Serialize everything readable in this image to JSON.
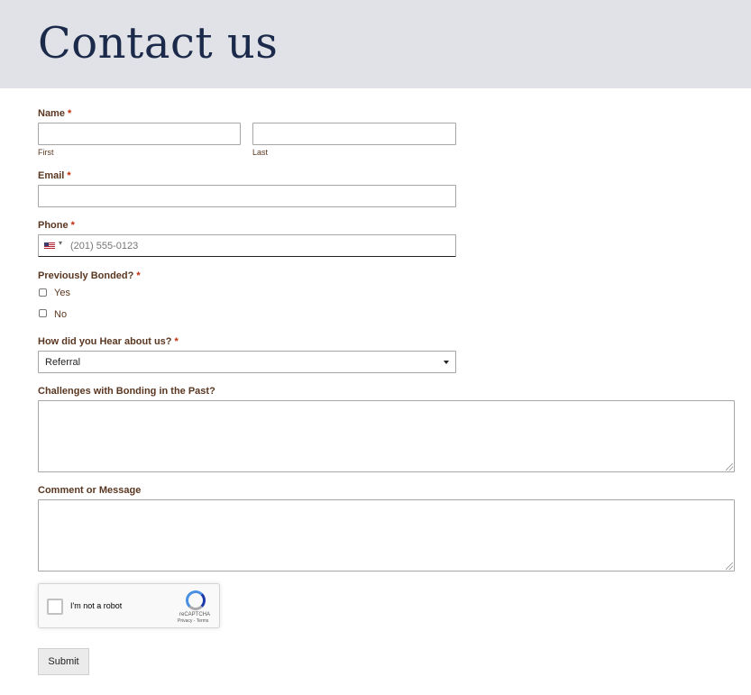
{
  "header": {
    "title": "Contact us"
  },
  "form": {
    "name": {
      "label": "Name",
      "required": "*",
      "first_sublabel": "First",
      "last_sublabel": "Last",
      "first_value": "",
      "last_value": ""
    },
    "email": {
      "label": "Email",
      "required": "*",
      "value": ""
    },
    "phone": {
      "label": "Phone",
      "required": "*",
      "country": "US",
      "caret": "▾",
      "placeholder": "(201) 555-0123"
    },
    "bonded": {
      "label": "Previously Bonded?",
      "required": "*",
      "options": [
        "Yes",
        "No"
      ]
    },
    "hear": {
      "label": "How did you Hear about us?",
      "required": "*",
      "selected": "Referral"
    },
    "challenges": {
      "label": "Challenges with Bonding in the Past?",
      "value": ""
    },
    "comment": {
      "label": "Comment or Message",
      "value": ""
    },
    "recaptcha": {
      "text": "I'm not a robot",
      "brand": "reCAPTCHA",
      "links": "Privacy - Terms"
    },
    "submit_label": "Submit"
  }
}
